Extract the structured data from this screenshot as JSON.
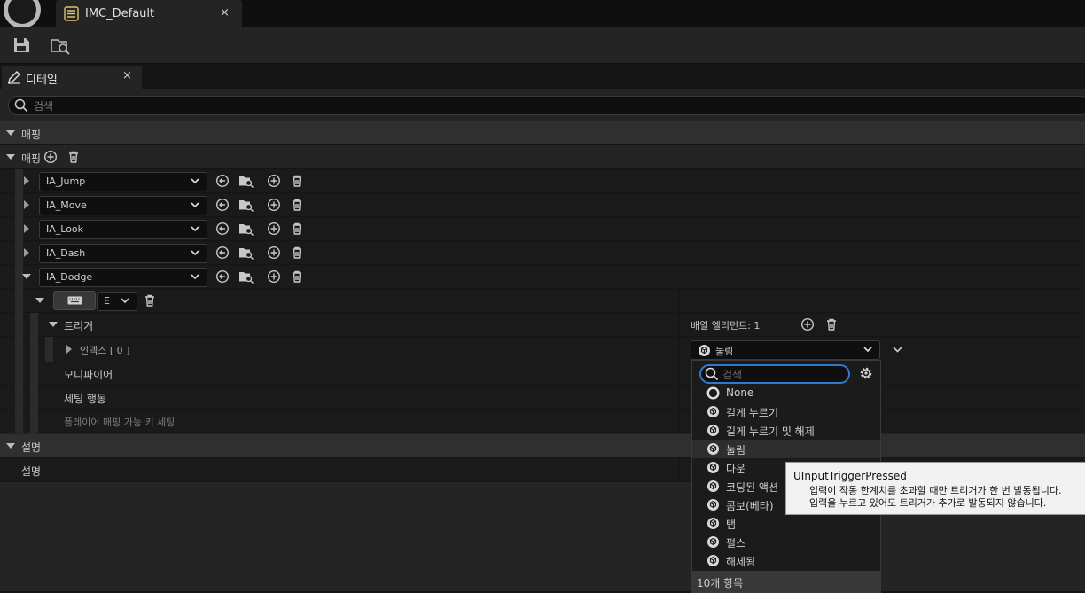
{
  "window": {
    "tab_title": "IMC_Default",
    "tab_close": "×"
  },
  "toolbar": {
    "save_icon": "save-icon",
    "browse_icon": "browse-asset-icon"
  },
  "details_tab": {
    "label": "디테일",
    "close": "×"
  },
  "search": {
    "placeholder": "검색"
  },
  "section_mappings": {
    "label": "매핑"
  },
  "mappings_array": {
    "label": "매핑"
  },
  "actions": [
    {
      "name": "IA_Jump"
    },
    {
      "name": "IA_Move"
    },
    {
      "name": "IA_Look"
    },
    {
      "name": "IA_Dash"
    },
    {
      "name": "IA_Dodge"
    }
  ],
  "dodge_key": {
    "value": "E"
  },
  "triggers": {
    "label": "트리거",
    "array_elements": "배열 엘리먼트: 1",
    "index_label": "인덱스 [ 0 ]",
    "selected_value": "눌림"
  },
  "modifiers": {
    "label": "모디파이어"
  },
  "setting_behavior": {
    "label": "세팅 행동"
  },
  "player_mappable": {
    "label": "플레이어 매핑 가능 키 세팅"
  },
  "section_description": {
    "label": "설명"
  },
  "description": {
    "label": "설명"
  },
  "menu": {
    "search_placeholder": "검색",
    "items": [
      {
        "label": "None"
      },
      {
        "label": "길게 누르기"
      },
      {
        "label": "길게 누르기 및 해제"
      },
      {
        "label": "눌림"
      },
      {
        "label": "다운"
      },
      {
        "label": "코딩된 액션"
      },
      {
        "label": "콤보(베타)"
      },
      {
        "label": "탭"
      },
      {
        "label": "펄스"
      },
      {
        "label": "해제됨"
      }
    ],
    "footer": "10개 항목"
  },
  "tooltip": {
    "title": "UInputTriggerPressed",
    "line1": "입력이 작동 한계치를 초과할 때만 트리거가 한 번 발동됩니다.",
    "line2": "입력을 누르고 있어도 트리거가 추가로 발동되지 않습니다."
  },
  "colors": {
    "accent": "#2f7ad1",
    "panel": "#242424",
    "tooltip_bg": "#f1f1f1"
  }
}
